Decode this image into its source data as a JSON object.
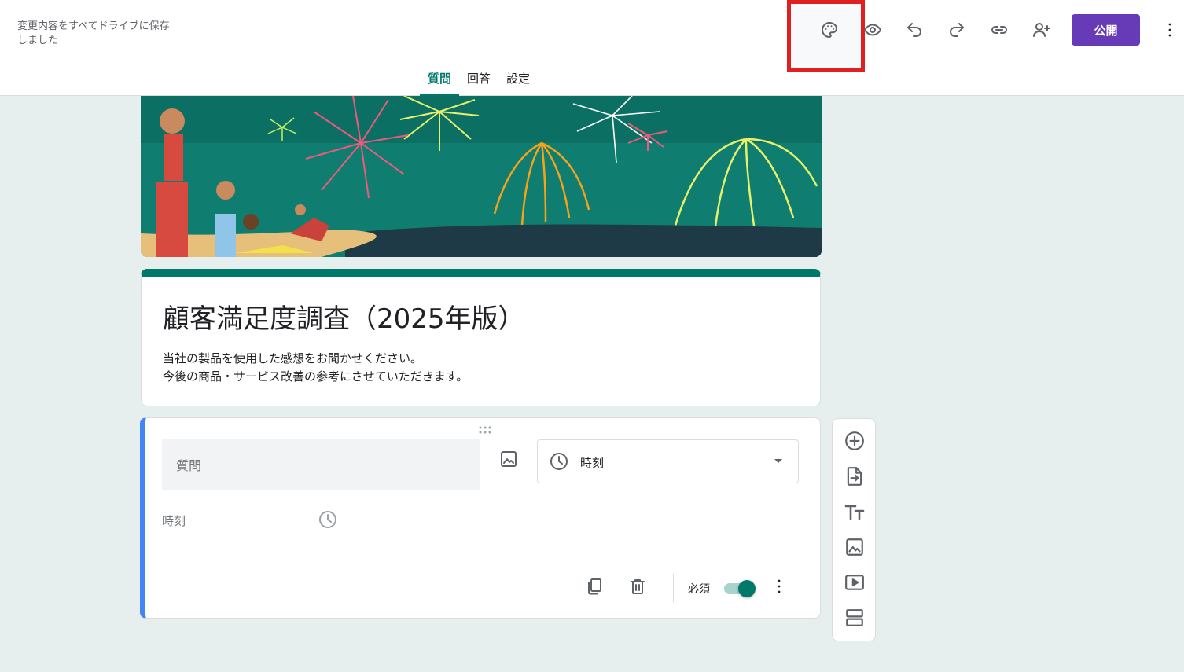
{
  "header": {
    "save_status": "変更内容をすべてドライブに保存しました",
    "publish_label": "公開",
    "icons": [
      "palette-icon",
      "preview-eye-icon",
      "undo-icon",
      "redo-icon",
      "link-icon",
      "add-collaborator-icon",
      "more-vert-icon"
    ]
  },
  "tabs": [
    {
      "label": "質問",
      "active": true
    },
    {
      "label": "回答",
      "active": false
    },
    {
      "label": "設定",
      "active": false
    }
  ],
  "form": {
    "title": "顧客満足度調査（2025年版）",
    "description_line1": "当社の製品を使用した感想をお聞かせください。",
    "description_line2": "今後の商品・サービス改善の参考にさせていただきます。"
  },
  "question": {
    "placeholder": "質問",
    "type_label": "時刻",
    "answer_placeholder": "時刻",
    "required_label": "必須",
    "required": true
  },
  "side_toolbar": {
    "icons": [
      "add-question-icon",
      "import-questions-icon",
      "add-title-icon",
      "add-image-icon",
      "add-video-icon",
      "add-section-icon"
    ]
  },
  "colors": {
    "accent": "#00796b",
    "publish": "#673ab7",
    "focus_bar": "#4285f4",
    "highlight_box": "#e02020",
    "background": "#e6efed"
  }
}
